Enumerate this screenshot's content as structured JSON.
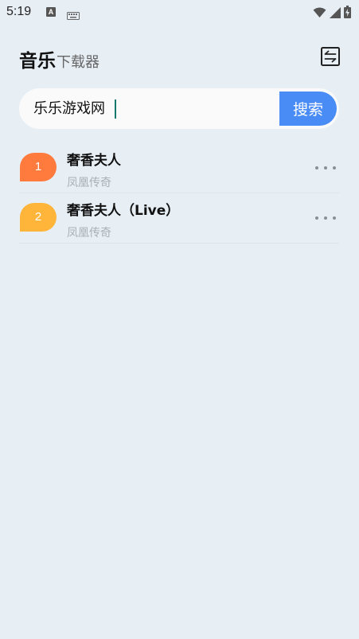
{
  "status_bar": {
    "time": "5:19",
    "notification_icon_letter": "A",
    "icons": [
      "keyboard-icon",
      "wifi-icon",
      "signal-icon",
      "battery-charging-icon"
    ]
  },
  "header": {
    "title_main": "音乐",
    "title_sub": "下载器",
    "switch_icon": "switch-icon"
  },
  "search": {
    "value": "乐乐游戏网",
    "button_label": "搜索"
  },
  "results": [
    {
      "rank": "1",
      "title": "奢香夫人",
      "artist": "凤凰传奇",
      "badge_color": "#ff7a3d"
    },
    {
      "rank": "2",
      "title": "奢香夫人（Live）",
      "artist": "凤凰传奇",
      "badge_color": "#ffb43a"
    }
  ],
  "colors": {
    "background": "#e7eff5",
    "accent": "#4a8cf5",
    "caret": "#0f7a6c"
  }
}
